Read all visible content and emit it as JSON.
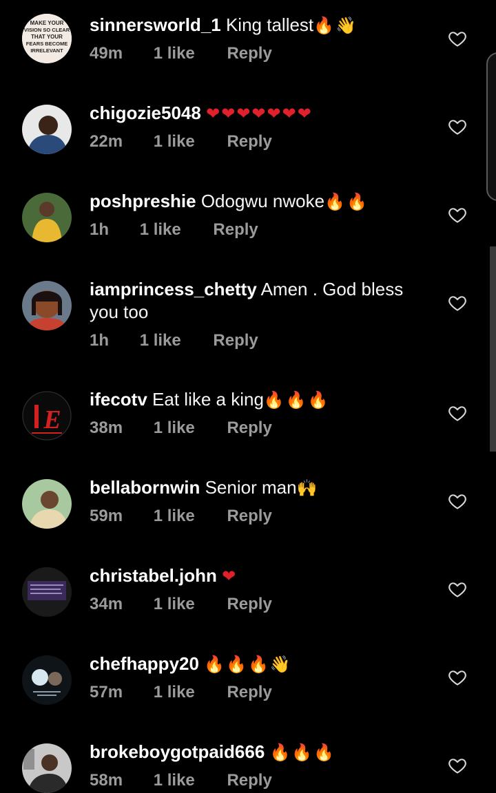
{
  "comments": [
    {
      "username": "sinnersworld_1",
      "text": "King tallest",
      "emoji": "🔥👋",
      "emoji_class": "fire",
      "time": "49m",
      "likes": "1 like",
      "reply": "Reply"
    },
    {
      "username": "chigozie5048",
      "text": "",
      "emoji": "❤❤❤❤❤❤❤",
      "emoji_class": "red",
      "time": "22m",
      "likes": "1 like",
      "reply": "Reply"
    },
    {
      "username": "poshpreshie",
      "text": "Odogwu nwoke",
      "emoji": "🔥🔥",
      "emoji_class": "fire",
      "time": "1h",
      "likes": "1 like",
      "reply": "Reply"
    },
    {
      "username": "iamprincess_chetty",
      "text": "Amen . God bless you too",
      "emoji": "",
      "emoji_class": "fire",
      "time": "1h",
      "likes": "1 like",
      "reply": "Reply"
    },
    {
      "username": "ifecotv",
      "text": "Eat like a king",
      "emoji": "🔥🔥🔥",
      "emoji_class": "fire",
      "time": "38m",
      "likes": "1 like",
      "reply": "Reply"
    },
    {
      "username": "bellabornwin",
      "text": "Senior man",
      "emoji": "🙌",
      "emoji_class": "gold",
      "time": "59m",
      "likes": "1 like",
      "reply": "Reply"
    },
    {
      "username": "christabel.john",
      "text": "",
      "emoji": "❤",
      "emoji_class": "red",
      "time": "34m",
      "likes": "1 like",
      "reply": "Reply"
    },
    {
      "username": "chefhappy20",
      "text": "",
      "emoji": "🔥🔥🔥👋",
      "emoji_class": "fire",
      "time": "57m",
      "likes": "1 like",
      "reply": "Reply"
    },
    {
      "username": "brokeboygotpaid666",
      "text": "",
      "emoji": "🔥🔥🔥",
      "emoji_class": "fire",
      "time": "58m",
      "likes": "1 like",
      "reply": "Reply"
    }
  ],
  "avatar_1_text": [
    "MAKE YOUR",
    "VISION SO CLEAR",
    "THAT YOUR",
    "FEARS BECOME",
    "IRRELEVANT"
  ],
  "avatar_5_text": "E"
}
